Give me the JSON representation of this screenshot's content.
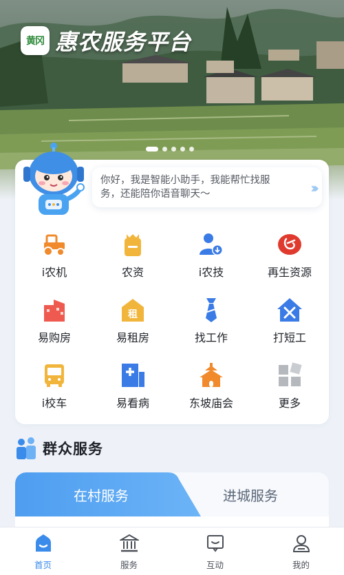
{
  "app": {
    "title": "惠农服务平台",
    "logo_text": "黄冈"
  },
  "banner": {
    "slide_count": 5,
    "active_slide": 1
  },
  "assistant": {
    "message": "你好，我是智能小助手，我能帮忙找服务，还能陪你语音聊天～",
    "arrow": "›››"
  },
  "services": [
    {
      "label": "i农机",
      "icon": "tractor-icon",
      "color": "#f08a2c"
    },
    {
      "label": "农资",
      "icon": "supplies-bag-icon",
      "color": "#f2b53c"
    },
    {
      "label": "i农技",
      "icon": "farmer-expert-icon",
      "color": "#3a7be6"
    },
    {
      "label": "再生资源",
      "icon": "recycle-icon",
      "color": "#e03a2f"
    },
    {
      "label": "易购房",
      "icon": "building-icon",
      "color": "#ee5a4f"
    },
    {
      "label": "易租房",
      "icon": "rent-house-icon",
      "color": "#f2b53c",
      "badge": "租"
    },
    {
      "label": "找工作",
      "icon": "tie-icon",
      "color": "#3a7be6"
    },
    {
      "label": "打短工",
      "icon": "tools-house-icon",
      "color": "#3a7be6"
    },
    {
      "label": "i校车",
      "icon": "school-bus-icon",
      "color": "#f2b53c"
    },
    {
      "label": "易看病",
      "icon": "hospital-icon",
      "color": "#3a7be6"
    },
    {
      "label": "东坡庙会",
      "icon": "temple-icon",
      "color": "#f08a2c"
    },
    {
      "label": "更多",
      "icon": "more-grid-icon",
      "color": "#b5b8bd"
    }
  ],
  "public_services": {
    "title": "群众服务",
    "tabs": [
      {
        "label": "在村服务",
        "active": true
      },
      {
        "label": "进城服务",
        "active": false
      }
    ]
  },
  "bottom_nav": [
    {
      "label": "首页",
      "icon": "home-icon",
      "active": true
    },
    {
      "label": "服务",
      "icon": "bank-icon",
      "active": false
    },
    {
      "label": "互动",
      "icon": "chat-icon",
      "active": false
    },
    {
      "label": "我的",
      "icon": "profile-icon",
      "active": false
    }
  ],
  "colors": {
    "accent": "#3a8bea",
    "background": "#eef2f8"
  }
}
